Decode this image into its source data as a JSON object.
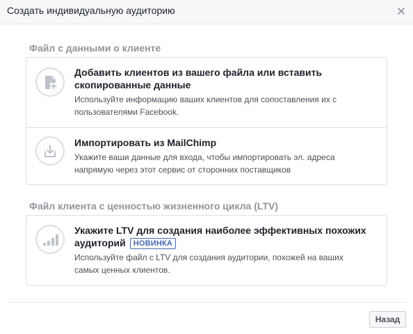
{
  "dialog": {
    "title": "Создать индивидуальную аудиторию",
    "close_icon": "close-icon"
  },
  "sections": [
    {
      "title": "Файл с данными о клиенте",
      "options": [
        {
          "icon": "file-add-icon",
          "title": "Добавить клиентов из вашего файла или вставить скопированные данные",
          "description": "Используйте информацию ваших клиентов для сопоставления их с пользователями Facebook."
        },
        {
          "icon": "import-icon",
          "title": "Импортировать из MailChimp",
          "description": "Укажите ваши данные для входа, чтобы импортировать эл. адреса напрямую через этот сервис от сторонних поставщиков"
        }
      ]
    },
    {
      "title": "Файл клиента с ценностью жизненного цикла (LTV)",
      "options": [
        {
          "icon": "bar-chart-icon",
          "title": "Укажите LTV для создания наиболее эффективных похожих аудиторий",
          "badge": "НОВИНКА",
          "description": "Используйте файл с LTV для создания аудитории, похожей на ваших самых ценных клиентов."
        }
      ]
    }
  ],
  "footer": {
    "back_label": "Назад"
  },
  "colors": {
    "accent": "#4267b2",
    "text": "#1d2129",
    "muted": "#90949c",
    "border": "#dddfe2"
  }
}
